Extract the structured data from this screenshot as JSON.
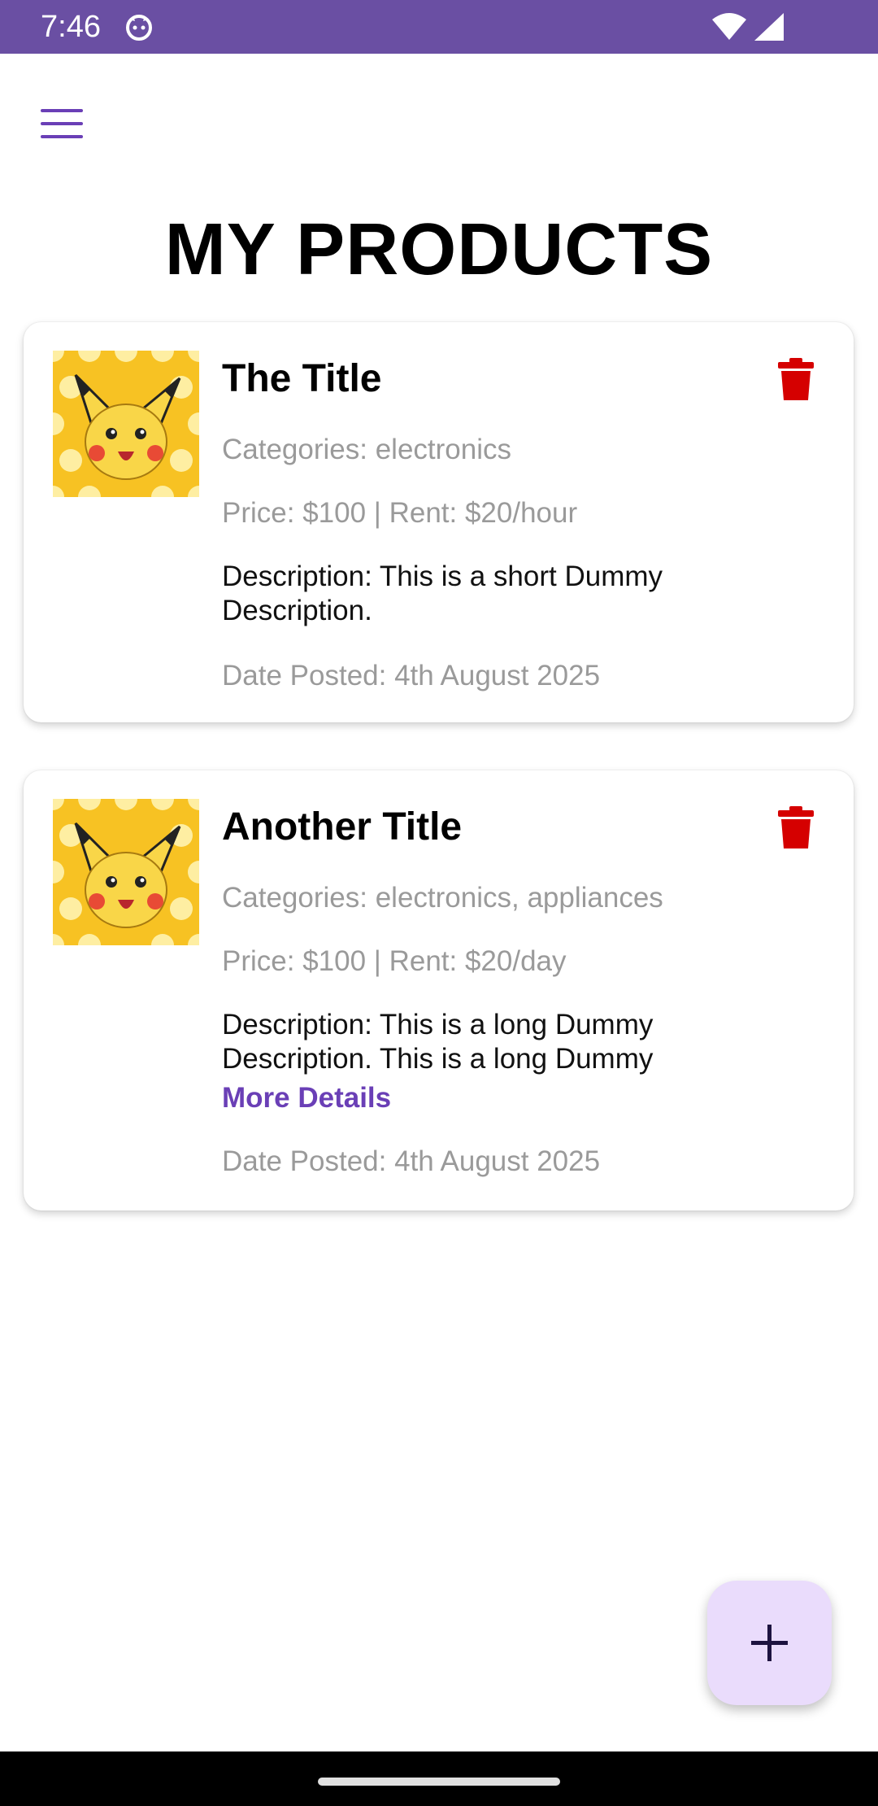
{
  "status_bar": {
    "time": "7:46"
  },
  "header": {
    "title": "MY PRODUCTS"
  },
  "products": [
    {
      "title": "The Title",
      "categories": "Categories: electronics",
      "price": "Price: $100 | Rent: $20/hour",
      "description": "Description: This is a short Dummy Description.",
      "date": "Date Posted: 4th August 2025"
    },
    {
      "title": "Another Title",
      "categories": "Categories: electronics, appliances",
      "price": "Price: $100 | Rent: $20/day",
      "description": "Description: This is a long Dummy Description. This is a long Dummy",
      "more": "More Details",
      "date": "Date Posted: 4th August 2025"
    }
  ],
  "colors": {
    "status_bar": "#6a4fa3",
    "accent": "#6a3fb6",
    "delete": "#d50000",
    "fab_bg": "#eadcfc"
  },
  "icons": {
    "menu": "hamburger-icon",
    "delete": "trash-icon",
    "add": "plus-icon"
  }
}
